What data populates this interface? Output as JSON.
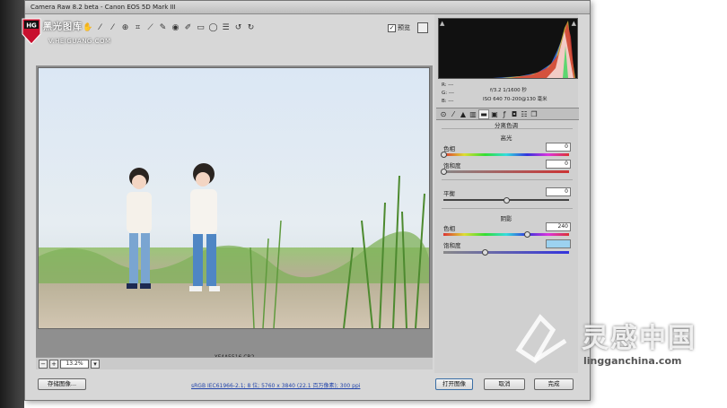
{
  "window": {
    "title": "Camera Raw 8.2 beta - Canon EOS 5D Mark III"
  },
  "logo": {
    "badge": "HG",
    "brand": "黑光图库",
    "url": "V.HEIGUANG.COM"
  },
  "toolbar": {
    "tool_icons": [
      "zoom-icon",
      "hand-icon",
      "white-balance-icon",
      "color-sampler-icon",
      "target-adjust-icon",
      "crop-icon",
      "straighten-icon",
      "spot-removal-icon",
      "red-eye-icon",
      "adjustment-brush-icon",
      "graduated-filter-icon",
      "radial-filter-icon",
      "preferences-icon",
      "rotate-ccw-icon",
      "rotate-cw-icon"
    ],
    "preview_label": "预览",
    "preview_checked": true
  },
  "photo": {
    "filename": "XF4A5516.CR2"
  },
  "statusbar": {
    "zoom_value": "13.2%",
    "zoom_out": "−",
    "zoom_in": "+"
  },
  "meta": {
    "r": "R:  ---",
    "g": "G:  ---",
    "b": "B:  ---",
    "exposure": "f/3.2   1/1600 秒",
    "iso": "ISO 640   70-200@130 毫米"
  },
  "panel": {
    "title": "分离色调",
    "highlights": {
      "heading": "高光",
      "hue_label": "色相",
      "hue_value": "0",
      "hue_level": 0,
      "sat_label": "饱和度",
      "sat_value": "0",
      "sat_level": 0
    },
    "balance": {
      "label": "平衡",
      "value": "0",
      "level": 0.5
    },
    "shadows": {
      "heading": "阴影",
      "hue_label": "色相",
      "hue_value": "240",
      "hue_level": 0.667,
      "sat_label": "饱和度",
      "sat_value": "",
      "sat_level": 0.33
    }
  },
  "buttons": {
    "save": "存储图像...",
    "workflow": "sRGB IEC61966-2.1; 8 位; 5760 x 3840 (22.1 百万像素); 300 ppi",
    "open": "打开图像",
    "cancel": "取消",
    "done": "完成"
  },
  "watermark": {
    "cn": "灵感中国",
    "url": "lingganchina.com"
  },
  "colors": {
    "accent": "#3a6ea5",
    "panel_bg": "#d0d0d0",
    "active_field": "#9cd2f0"
  }
}
